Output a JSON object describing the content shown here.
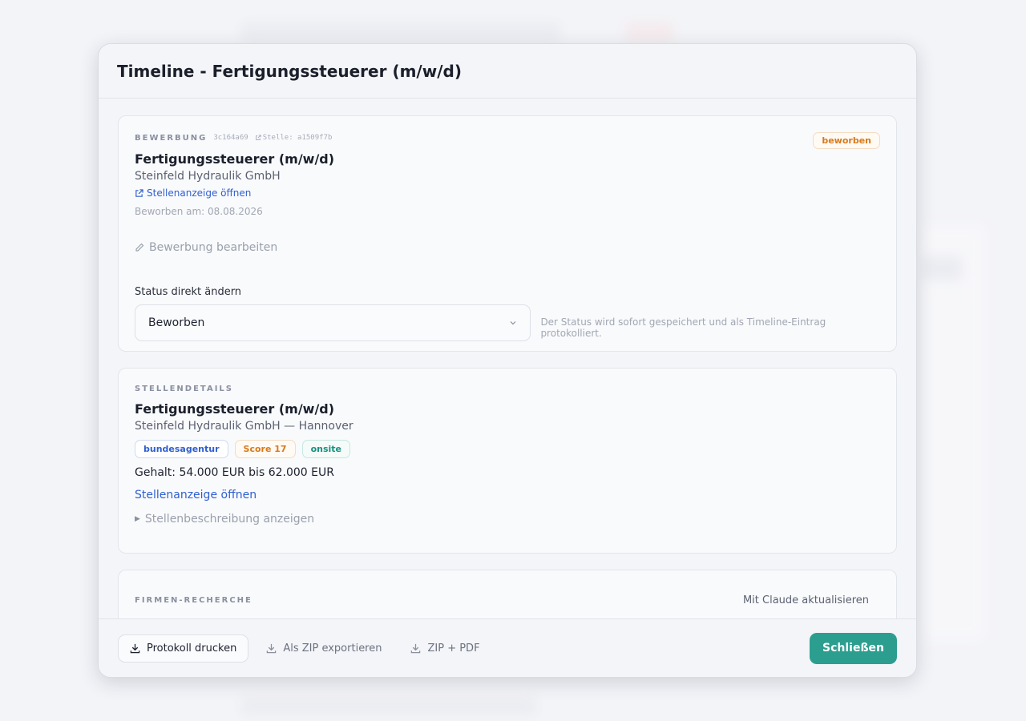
{
  "modal": {
    "title": "Timeline - Fertigungssteuerer (m/w/d)"
  },
  "application": {
    "section_label": "BEWERBUNG",
    "id": "3c164a69",
    "job_ref": "Stelle: a1509f7b",
    "status_badge": "beworben",
    "title": "Fertigungssteuerer (m/w/d)",
    "company": "Steinfeld Hydraulik GmbH",
    "open_posting_link": "Stellenanzeige öffnen",
    "applied_on": "Beworben am: 08.08.2026",
    "edit_link": "Bewerbung bearbeiten",
    "status_change_label": "Status direkt ändern",
    "status_value": "Beworben",
    "status_hint": "Der Status wird sofort gespeichert und als Timeline-Eintrag protokolliert."
  },
  "job_details": {
    "section_label": "STELLENDETAILS",
    "title": "Fertigungssteuerer (m/w/d)",
    "company_location": "Steinfeld Hydraulik GmbH — Hannover",
    "tags": [
      "bundesagentur",
      "Score 17",
      "onsite"
    ],
    "salary": "Gehalt: 54.000 EUR bis 62.000 EUR",
    "open_posting_link": "Stellenanzeige öffnen",
    "show_description": "Stellenbeschreibung anzeigen"
  },
  "research": {
    "section_label": "FIRMEN-RECHERCHE",
    "refresh_button": "Mit Claude aktualisieren"
  },
  "footer": {
    "print_button": "Protokoll drucken",
    "zip_button": "Als ZIP exportieren",
    "zip_pdf_button": "ZIP + PDF",
    "close_button": "Schließen"
  },
  "colors": {
    "accent": "#2c9e8f",
    "link": "#2f5fd0",
    "status_orange": "#d77a1c"
  },
  "icons": {
    "external": "external-link-icon",
    "edit": "pencil-icon",
    "chevron": "chevron-down-icon",
    "download": "download-icon"
  }
}
